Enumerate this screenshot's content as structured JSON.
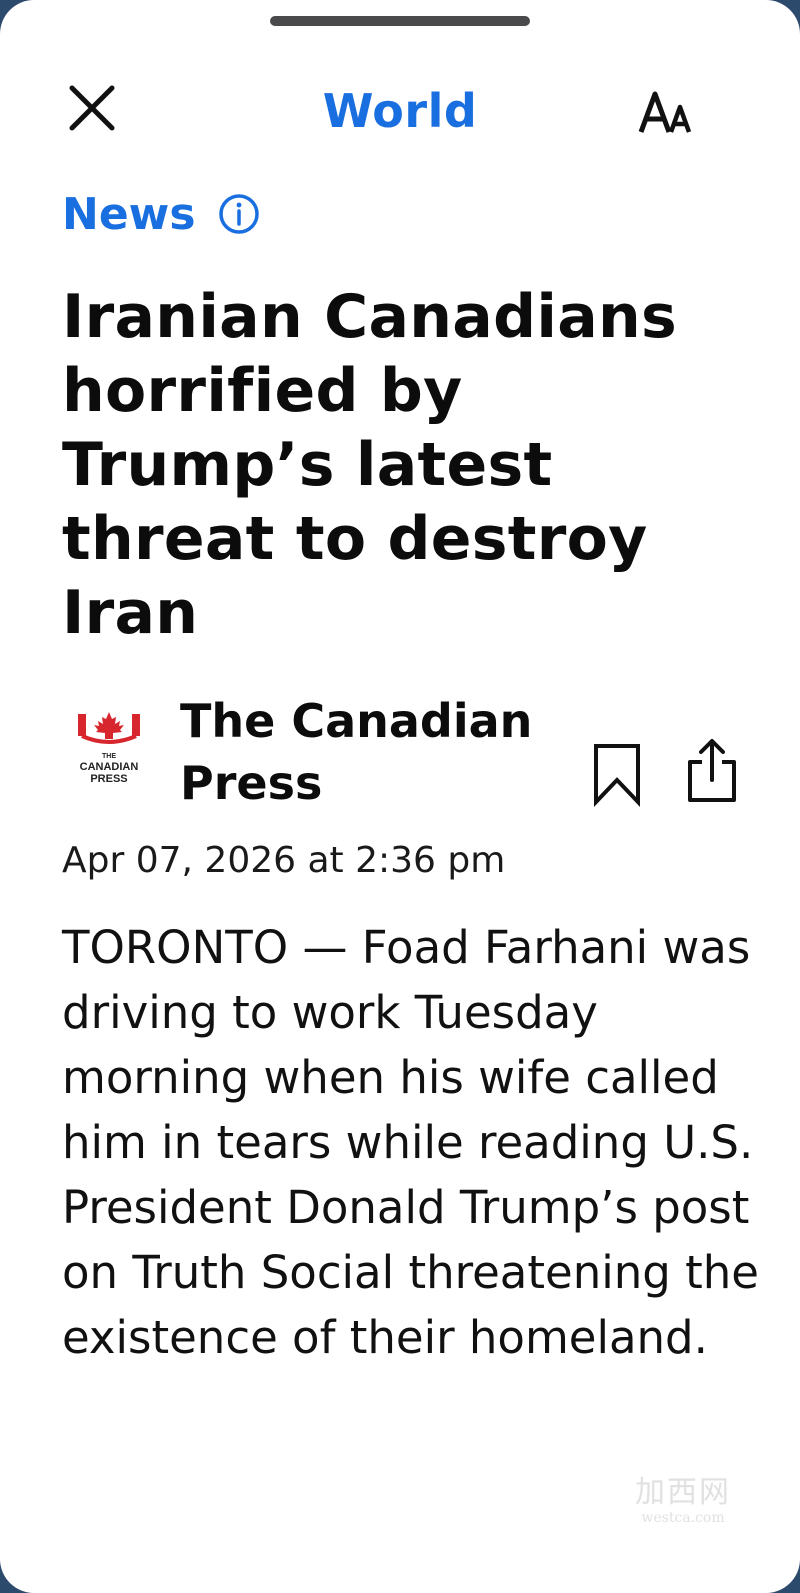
{
  "header": {
    "section_title": "World",
    "close_icon": "close-icon",
    "text_size_icon": "text-size-icon"
  },
  "article": {
    "category": "News",
    "category_info_icon": "info-icon",
    "headline": "Iranian Canadians horrified by Trump’s latest threat to destroy Iran",
    "source": {
      "name": "The Canadian Press",
      "logo_text_line1": "THE",
      "logo_text_line2": "CANADIAN",
      "logo_text_line3": "PRESS"
    },
    "timestamp": "Apr 07, 2026 at 2:36 pm",
    "body": "TORONTO — Foad Farhani was driving to work Tuesday morning when his wife called him in tears while reading U.S. President Donald Trump’s post on Truth Social threatening the existence of their homeland."
  },
  "actions": {
    "bookmark_icon": "bookmark-icon",
    "share_icon": "share-icon"
  },
  "watermark": {
    "main": "加西网",
    "sub": "westca.com"
  },
  "colors": {
    "accent": "#1a6fe0",
    "text": "#111111",
    "logo_red": "#d8262f"
  }
}
